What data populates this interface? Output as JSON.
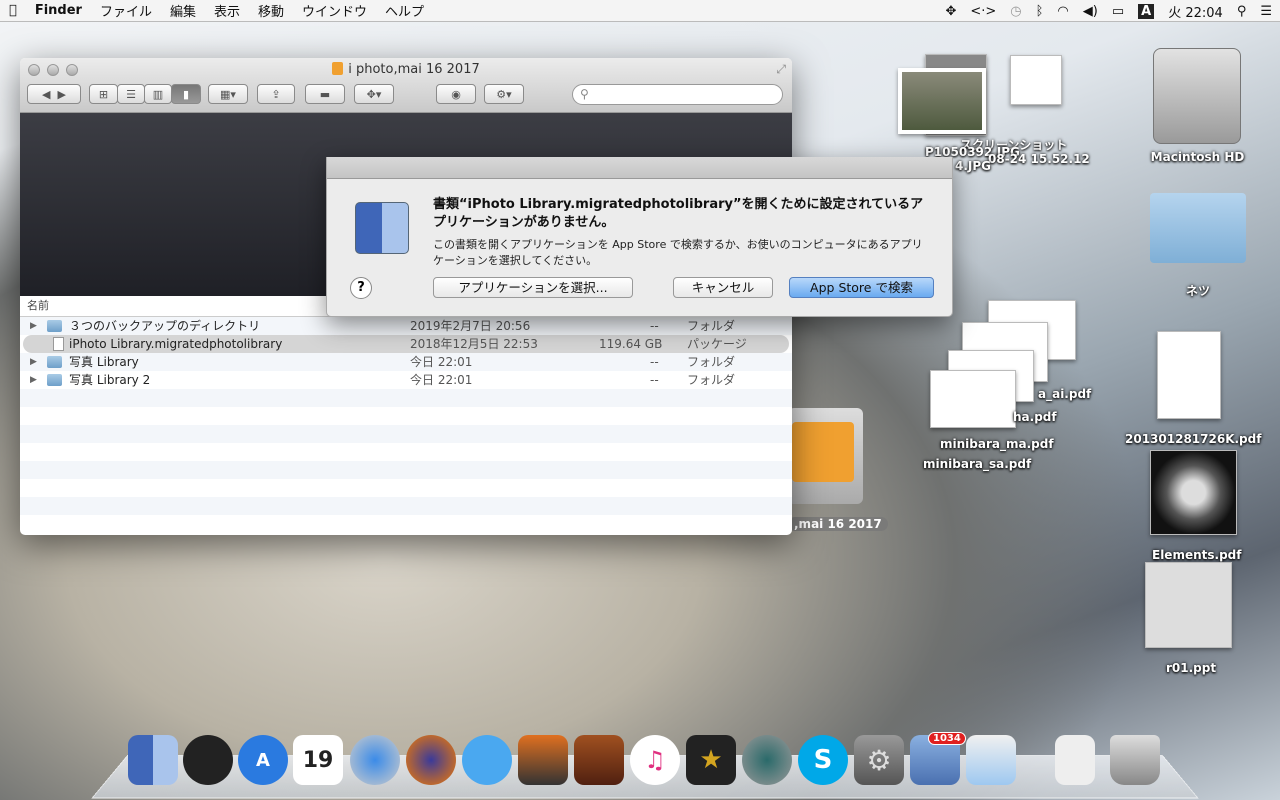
{
  "menubar": {
    "app": "Finder",
    "items": [
      "ファイル",
      "編集",
      "表示",
      "移動",
      "ウインドウ",
      "ヘルプ"
    ],
    "input_mode": "A",
    "clock": "火 22:04"
  },
  "window": {
    "title": "i photo,mai 16 2017",
    "search_placeholder": "",
    "column_name": "名前",
    "rows": [
      {
        "name": "３つのバックアップのディレクトリ",
        "date": "2019年2月7日 20:56",
        "size": "--",
        "kind": "フォルダ",
        "type": "folder"
      },
      {
        "name": "iPhoto Library.migratedphotolibrary",
        "date": "2018年12月5日 22:53",
        "size": "119.64 GB",
        "kind": "パッケージ",
        "type": "package"
      },
      {
        "name": "写真 Library",
        "date": "今日 22:01",
        "size": "--",
        "kind": "フォルダ",
        "type": "folder"
      },
      {
        "name": "写真 Library 2",
        "date": "今日 22:01",
        "size": "--",
        "kind": "フォルダ",
        "type": "folder"
      }
    ]
  },
  "dialog": {
    "message": "書類“iPhoto Library.migratedphotolibrary”を開くために設定されているアプリケーションがありません。",
    "info": "この書類を開くアプリケーションを App Store で検索するか、お使いのコンピュータにあるアプリケーションを選択してください。",
    "help": "?",
    "choose": "アプリケーションを選択...",
    "cancel": "キャンセル",
    "search": "App Store で検索"
  },
  "desktop": {
    "photo1": "P1050392.JPG",
    "photo1b": "4.JPG",
    "screenshot": "スクリーンショット",
    "screenshot_b": "08-24 15.52.12",
    "hd": "Macintosh HD",
    "folder": "ネツ",
    "pdf_ai": "a_ai.pdf",
    "pdf_ha": "ha.pdf",
    "pdf_ma": "minibara_ma.pdf",
    "pdf_sa": "minibara_sa.pdf",
    "pdf_k": "201301281726K.pdf",
    "elements": "Elements.pdf",
    "ppt": "r01.ppt",
    "usb": ",mai 16 2017"
  },
  "dock": {
    "calendar_day": "19",
    "mail_badge": "1034",
    "skype": "S"
  }
}
